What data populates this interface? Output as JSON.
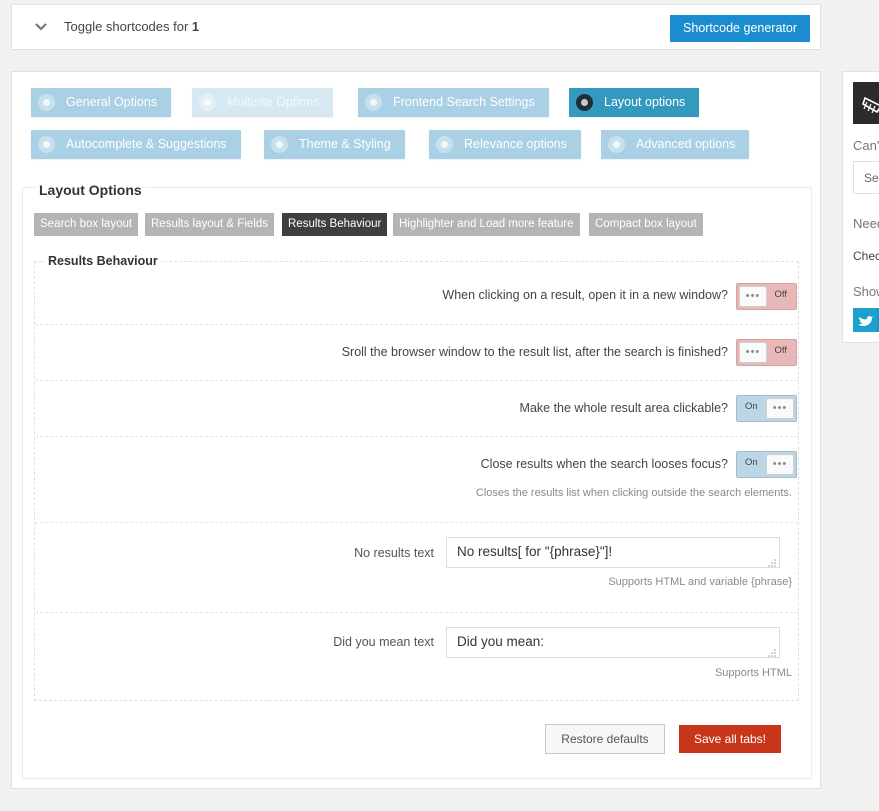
{
  "topbar": {
    "toggle_prefix": "Toggle shortcodes for ",
    "toggle_id": "1",
    "shortcode_button": "Shortcode generator"
  },
  "tabs": [
    {
      "label": "General Options",
      "icon": "gear-icon",
      "state": "normal"
    },
    {
      "label": "Multisite Options",
      "icon": "calendar-icon",
      "state": "disabled"
    },
    {
      "label": "Frontend Search Settings",
      "icon": "window-icon",
      "state": "normal"
    },
    {
      "label": "Layout options",
      "icon": "feather-icon",
      "state": "active"
    },
    {
      "label": "Autocomplete & Suggestions",
      "icon": "lightbulb-icon",
      "state": "normal"
    },
    {
      "label": "Theme & Styling",
      "icon": "eye-icon",
      "state": "normal"
    },
    {
      "label": "Relevance options",
      "icon": "cogs-icon",
      "state": "normal"
    },
    {
      "label": "Advanced options",
      "icon": "cogs-icon",
      "state": "normal"
    }
  ],
  "layout_options": {
    "title": "Layout Options",
    "subtabs": [
      {
        "label": "Search box layout",
        "active": false
      },
      {
        "label": "Results layout & Fields",
        "active": false
      },
      {
        "label": "Results Behaviour",
        "active": true
      },
      {
        "label": "Highlighter and Load more feature",
        "active": false
      },
      {
        "label": "Compact box layout",
        "active": false
      }
    ]
  },
  "results_behaviour": {
    "title": "Results Behaviour",
    "options": [
      {
        "label": "When clicking on a result, open it in a new window?",
        "state": "Off",
        "desc": ""
      },
      {
        "label": "Sroll the browser window to the result list, after the search is finished?",
        "state": "Off",
        "desc": ""
      },
      {
        "label": "Make the whole result area clickable?",
        "state": "On",
        "desc": ""
      },
      {
        "label": "Close results when the search looses focus?",
        "state": "On",
        "desc": "Closes the results list when clicking outside the search elements."
      }
    ],
    "no_results": {
      "label": "No results text",
      "value": "No results[ for \"{phrase}\"]!",
      "help": "Supports HTML and variable {phrase}"
    },
    "did_you_mean": {
      "label": "Did you mean text",
      "value": "Did you mean:",
      "help": "Supports HTML"
    }
  },
  "actions": {
    "restore": "Restore defaults",
    "save": "Save all tabs!"
  },
  "sidebar": {
    "text1": "Can'",
    "input_placeholder": "Sea",
    "text2": "Need",
    "text3": "Chec",
    "text4": "Show"
  },
  "colors": {
    "tab": "#a9d0e4",
    "tab_active": "#3399bf",
    "save": "#c8361a",
    "shortcode": "#1a8ccf"
  }
}
